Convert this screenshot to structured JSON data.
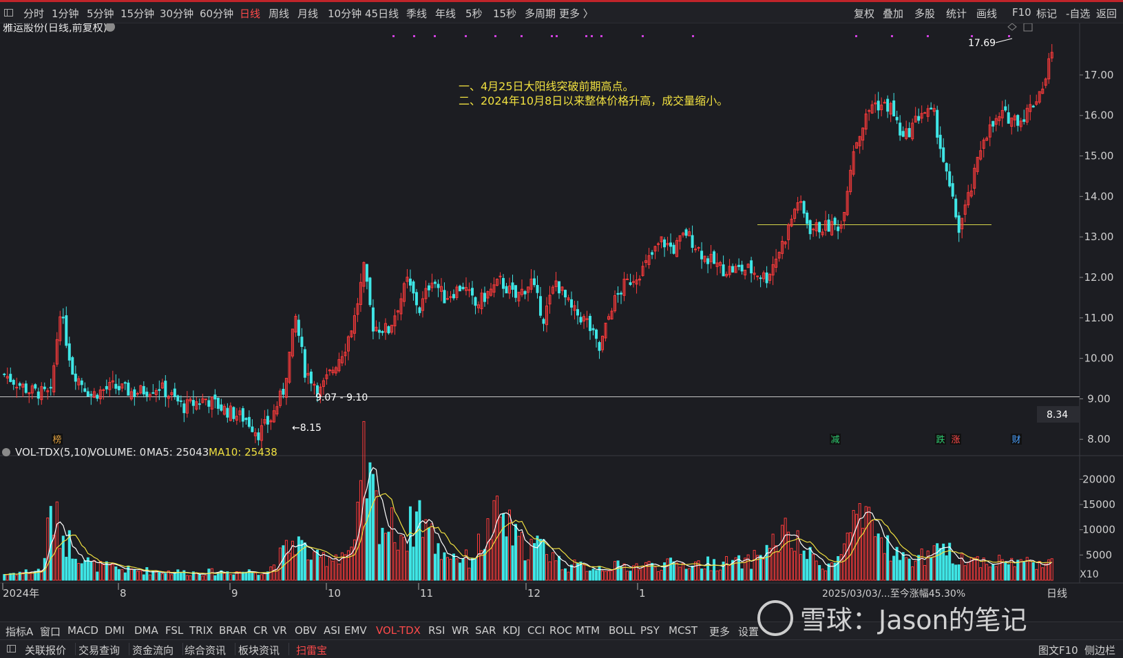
{
  "toolbar": {
    "periods": [
      "分时",
      "1分钟",
      "5分钟",
      "15分钟",
      "30分钟",
      "60分钟",
      "日线",
      "周线",
      "月线",
      "10分钟",
      "45日线",
      "季线",
      "年线",
      "5秒",
      "15秒",
      "多周期",
      "更多 〉"
    ],
    "active_period": "日线",
    "right_tools": [
      "复权",
      "叠加",
      "多股",
      "统计",
      "画线",
      "F10",
      "标记",
      "-自选",
      "返回"
    ]
  },
  "stock": {
    "title": "雅运股份(日线,前复权)"
  },
  "annotations": {
    "note_line1": "一、4月25日大阳线突破前期高点。",
    "note_line2": "二、2024年10月8日以来整体价格升高，成交量缩小。",
    "high_label": "17.69",
    "low_label": "8.15",
    "range_label": "9.07 - 9.10",
    "current_price_tag": "8.34"
  },
  "markers": [
    {
      "text": "榜",
      "color": "#e0a040"
    },
    {
      "text": "减",
      "color": "#2ecc71"
    },
    {
      "text": "跌",
      "color": "#2ecc71"
    },
    {
      "text": "涨",
      "color": "#ff4a4a"
    },
    {
      "text": "财",
      "color": "#4aa0ff"
    }
  ],
  "volume_panel": {
    "indicator": "VOL-TDX(5,10)",
    "volume": "VOLUME: 0",
    "ma5": "MA5: 25043",
    "ma10": "MA10: 25438",
    "scale": "X10"
  },
  "time_axis": {
    "labels": [
      "2024年",
      "8",
      "9",
      "10",
      "11",
      "12",
      "1"
    ],
    "period_label": "日线",
    "range_text": "2025/03/03/...至今涨幅45.30%"
  },
  "indicator_tabs": [
    "指标A",
    "窗口",
    "MACD",
    "DMI",
    "DMA",
    "FSL",
    "TRIX",
    "BRAR",
    "CR",
    "VR",
    "OBV",
    "ASI",
    "EMV",
    "VOL-TDX",
    "RSI",
    "WR",
    "SAR",
    "KDJ",
    "CCI",
    "ROC",
    "MTM",
    "BOLL",
    "PSY",
    "MCST",
    "更多",
    "设置"
  ],
  "active_indicator": "VOL-TDX",
  "bottom_tabs": [
    "关联报价",
    "交易查询",
    "资金流向",
    "综合资讯",
    "板块资讯",
    "扫雷宝"
  ],
  "bottom_right": [
    "图文F10",
    "侧边栏"
  ],
  "watermark": "雪球：Jason的笔记",
  "colors": {
    "up": "#ff3b3b",
    "down": "#3fe6e6",
    "ma5": "#ffffff",
    "ma10": "#f0e040",
    "note": "#f0e040",
    "bg": "#1c1d22"
  },
  "chart_data": {
    "type": "candlestick",
    "title": "雅运股份(日线,前复权)",
    "y_ticks": [
      8.0,
      9.0,
      10.0,
      11.0,
      12.0,
      13.0,
      14.0,
      15.0,
      16.0,
      17.0
    ],
    "ylim": [
      7.8,
      17.9
    ],
    "volume_ticks": [
      5000,
      10000,
      15000,
      20000
    ],
    "volume_ylim": [
      0,
      22500
    ],
    "reference_lines": [
      {
        "value": 9.05,
        "color": "#c8c8c8"
      },
      {
        "value": 13.3,
        "color": "#d8d84a"
      }
    ],
    "waypoints": [
      [
        0,
        9.6
      ],
      [
        8,
        9.2
      ],
      [
        15,
        9.1
      ],
      [
        18,
        11.2
      ],
      [
        22,
        9.7
      ],
      [
        28,
        9.1
      ],
      [
        35,
        9.3
      ],
      [
        42,
        9.15
      ],
      [
        50,
        9.3
      ],
      [
        58,
        8.8
      ],
      [
        65,
        9.0
      ],
      [
        72,
        8.7
      ],
      [
        78,
        8.5
      ],
      [
        82,
        8.15
      ],
      [
        86,
        8.5
      ],
      [
        90,
        9.2
      ],
      [
        94,
        11.0
      ],
      [
        97,
        9.7
      ],
      [
        102,
        9.2
      ],
      [
        110,
        10.3
      ],
      [
        113,
        11.0
      ],
      [
        116,
        12.2
      ],
      [
        119,
        10.8
      ],
      [
        124,
        10.7
      ],
      [
        130,
        11.9
      ],
      [
        134,
        11.2
      ],
      [
        138,
        12.0
      ],
      [
        142,
        11.5
      ],
      [
        148,
        11.8
      ],
      [
        152,
        11.3
      ],
      [
        160,
        11.9
      ],
      [
        165,
        11.5
      ],
      [
        170,
        11.9
      ],
      [
        174,
        11.0
      ],
      [
        178,
        11.9
      ],
      [
        183,
        11.2
      ],
      [
        188,
        10.9
      ],
      [
        192,
        10.2
      ],
      [
        196,
        11.3
      ],
      [
        200,
        11.8
      ],
      [
        206,
        12.2
      ],
      [
        212,
        12.9
      ],
      [
        216,
        12.7
      ],
      [
        220,
        13.1
      ],
      [
        226,
        12.5
      ],
      [
        232,
        12.2
      ],
      [
        240,
        12.2
      ],
      [
        246,
        12.0
      ],
      [
        252,
        13.0
      ],
      [
        256,
        13.9
      ],
      [
        260,
        13.2
      ],
      [
        270,
        13.3
      ],
      [
        274,
        15.2
      ],
      [
        280,
        16.3
      ],
      [
        286,
        16.2
      ],
      [
        290,
        15.4
      ],
      [
        296,
        16.1
      ],
      [
        300,
        16.0
      ],
      [
        304,
        14.5
      ],
      [
        308,
        13.2
      ],
      [
        312,
        14.2
      ],
      [
        316,
        15.5
      ],
      [
        322,
        16.0
      ],
      [
        328,
        15.9
      ],
      [
        332,
        16.3
      ],
      [
        336,
        16.9
      ],
      [
        338,
        17.69
      ]
    ],
    "volume_waypoints": [
      [
        0,
        1200
      ],
      [
        12,
        2000
      ],
      [
        15,
        13000
      ],
      [
        20,
        8000
      ],
      [
        28,
        3000
      ],
      [
        40,
        2000
      ],
      [
        60,
        1500
      ],
      [
        85,
        1800
      ],
      [
        94,
        8000
      ],
      [
        100,
        4000
      ],
      [
        113,
        6000
      ],
      [
        116,
        22000
      ],
      [
        122,
        11000
      ],
      [
        130,
        9000
      ],
      [
        134,
        14000
      ],
      [
        140,
        6000
      ],
      [
        150,
        4000
      ],
      [
        160,
        13000
      ],
      [
        166,
        7000
      ],
      [
        175,
        6500
      ],
      [
        180,
        3000
      ],
      [
        190,
        2500
      ],
      [
        210,
        3000
      ],
      [
        240,
        3500
      ],
      [
        252,
        9000
      ],
      [
        262,
        3500
      ],
      [
        268,
        3000
      ],
      [
        274,
        11000
      ],
      [
        280,
        10000
      ],
      [
        290,
        4000
      ],
      [
        304,
        5500
      ],
      [
        312,
        4000
      ],
      [
        330,
        3500
      ],
      [
        338,
        4000
      ]
    ],
    "candle_count": 339
  }
}
